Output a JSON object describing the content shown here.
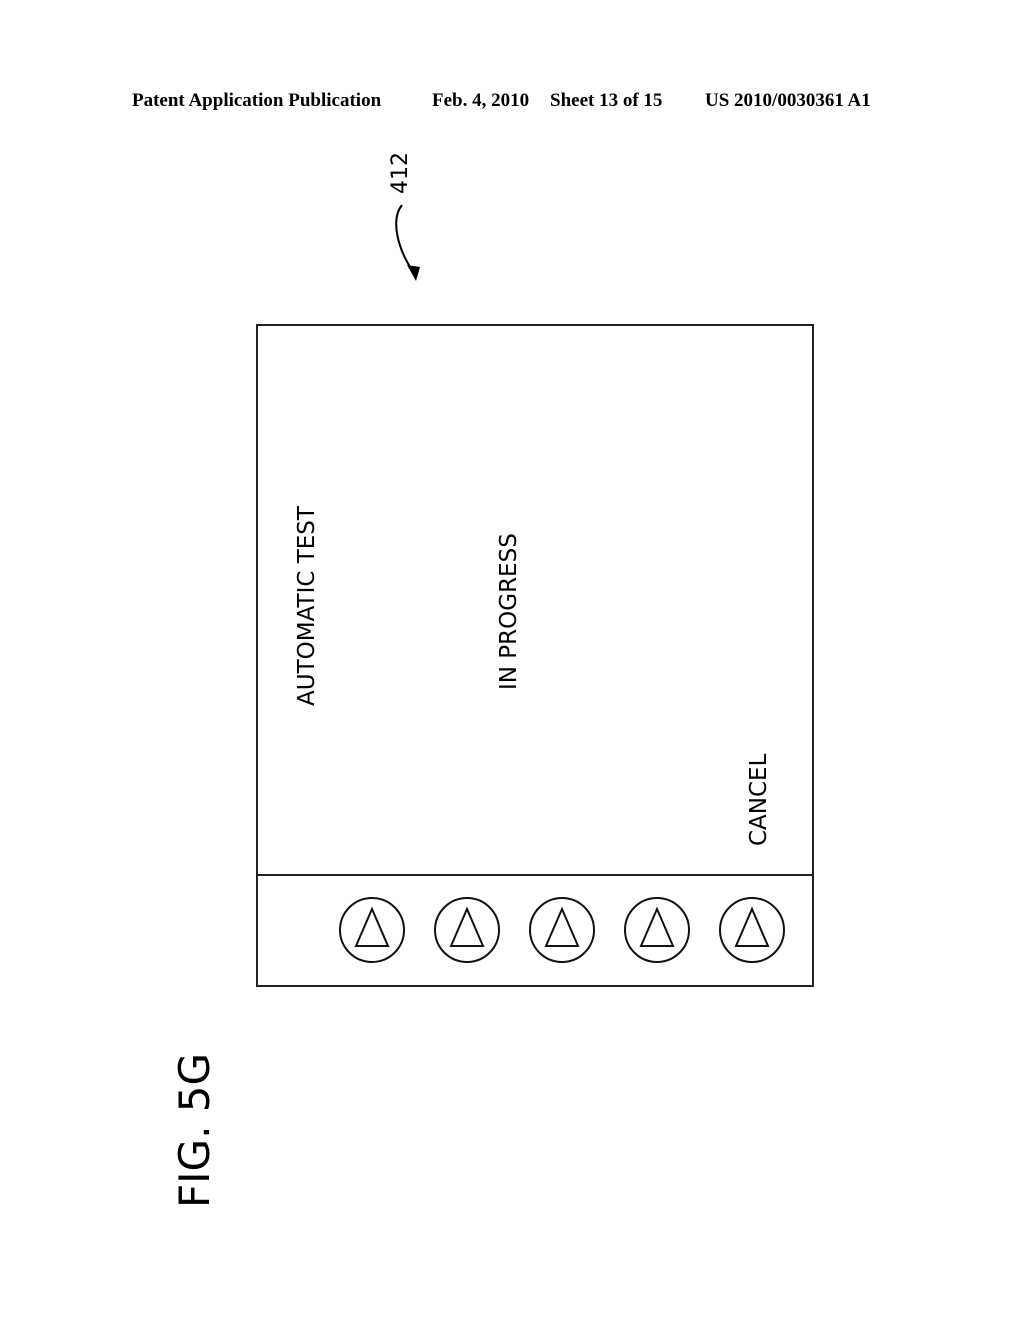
{
  "header": {
    "publication": "Patent Application Publication",
    "date": "Feb. 4, 2010",
    "sheet": "Sheet 13 of 15",
    "patent_number": "US 2010/0030361 A1"
  },
  "figure": {
    "reference_numeral": "412",
    "label": "FIG. 5G"
  },
  "screen": {
    "title_line": "AUTOMATIC TEST",
    "status_line": "IN PROGRESS",
    "softkey_label": "CANCEL"
  },
  "buttons": [
    {
      "icon": "triangle-up-icon"
    },
    {
      "icon": "triangle-up-icon"
    },
    {
      "icon": "triangle-up-icon"
    },
    {
      "icon": "triangle-up-icon"
    },
    {
      "icon": "triangle-up-icon"
    }
  ]
}
